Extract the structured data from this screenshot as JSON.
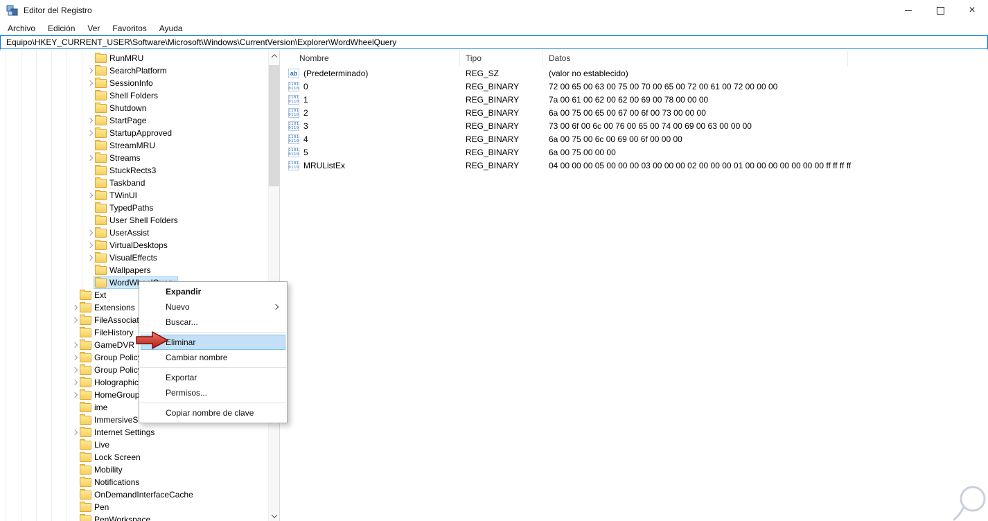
{
  "window": {
    "title": "Editor del Registro"
  },
  "menubar": {
    "items": [
      "Archivo",
      "Edición",
      "Ver",
      "Favoritos",
      "Ayuda"
    ]
  },
  "address_bar": {
    "value": "Equipo\\HKEY_CURRENT_USER\\Software\\Microsoft\\Windows\\CurrentVersion\\Explorer\\WordWheelQuery"
  },
  "icons": {
    "string_glyph": "ab",
    "binary_glyph": "1101\n0110"
  },
  "tree": {
    "items": [
      {
        "label": "RunMRU",
        "level": 2,
        "expandable": false
      },
      {
        "label": "SearchPlatform",
        "level": 2,
        "expandable": true
      },
      {
        "label": "SessionInfo",
        "level": 2,
        "expandable": true
      },
      {
        "label": "Shell Folders",
        "level": 2,
        "expandable": false
      },
      {
        "label": "Shutdown",
        "level": 2,
        "expandable": false
      },
      {
        "label": "StartPage",
        "level": 2,
        "expandable": true
      },
      {
        "label": "StartupApproved",
        "level": 2,
        "expandable": true
      },
      {
        "label": "StreamMRU",
        "level": 2,
        "expandable": false
      },
      {
        "label": "Streams",
        "level": 2,
        "expandable": true
      },
      {
        "label": "StuckRects3",
        "level": 2,
        "expandable": false
      },
      {
        "label": "Taskband",
        "level": 2,
        "expandable": false
      },
      {
        "label": "TWinUI",
        "level": 2,
        "expandable": true
      },
      {
        "label": "TypedPaths",
        "level": 2,
        "expandable": false
      },
      {
        "label": "User Shell Folders",
        "level": 2,
        "expandable": false
      },
      {
        "label": "UserAssist",
        "level": 2,
        "expandable": true
      },
      {
        "label": "VirtualDesktops",
        "level": 2,
        "expandable": true
      },
      {
        "label": "VisualEffects",
        "level": 2,
        "expandable": true
      },
      {
        "label": "Wallpapers",
        "level": 2,
        "expandable": false
      },
      {
        "label": "WordWheelQuery",
        "level": 2,
        "expandable": false,
        "selected": true
      },
      {
        "label": "Ext",
        "level": 1,
        "expandable": false
      },
      {
        "label": "Extensions",
        "level": 1,
        "expandable": true
      },
      {
        "label": "FileAssociation",
        "level": 1,
        "expandable": true
      },
      {
        "label": "FileHistory",
        "level": 1,
        "expandable": false
      },
      {
        "label": "GameDVR",
        "level": 1,
        "expandable": true
      },
      {
        "label": "Group Policy",
        "level": 1,
        "expandable": true
      },
      {
        "label": "Group Policy Objects",
        "level": 1,
        "expandable": true
      },
      {
        "label": "Holographic",
        "level": 1,
        "expandable": true
      },
      {
        "label": "HomeGroup",
        "level": 1,
        "expandable": true
      },
      {
        "label": "ime",
        "level": 1,
        "expandable": false
      },
      {
        "label": "ImmersiveShell",
        "level": 1,
        "expandable": false
      },
      {
        "label": "Internet Settings",
        "level": 1,
        "expandable": true
      },
      {
        "label": "Live",
        "level": 1,
        "expandable": false
      },
      {
        "label": "Lock Screen",
        "level": 1,
        "expandable": false
      },
      {
        "label": "Mobility",
        "level": 1,
        "expandable": false
      },
      {
        "label": "Notifications",
        "level": 1,
        "expandable": false
      },
      {
        "label": "OnDemandInterfaceCache",
        "level": 1,
        "expandable": false
      },
      {
        "label": "Pen",
        "level": 1,
        "expandable": false
      },
      {
        "label": "PenWorkspace",
        "level": 1,
        "expandable": false
      }
    ]
  },
  "list": {
    "columns": [
      {
        "label": "Nombre"
      },
      {
        "label": "Tipo"
      },
      {
        "label": "Datos"
      }
    ],
    "rows": [
      {
        "icon": "string",
        "name": "(Predeterminado)",
        "type": "REG_SZ",
        "data": "(valor no establecido)"
      },
      {
        "icon": "binary",
        "name": "0",
        "type": "REG_BINARY",
        "data": "72 00 65 00 63 00 75 00 70 00 65 00 72 00 61 00 72 00 00 00"
      },
      {
        "icon": "binary",
        "name": "1",
        "type": "REG_BINARY",
        "data": "7a 00 61 00 62 00 62 00 69 00 78 00 00 00"
      },
      {
        "icon": "binary",
        "name": "2",
        "type": "REG_BINARY",
        "data": "6a 00 75 00 65 00 67 00 6f 00 73 00 00 00"
      },
      {
        "icon": "binary",
        "name": "3",
        "type": "REG_BINARY",
        "data": "73 00 6f 00 6c 00 76 00 65 00 74 00 69 00 63 00 00 00"
      },
      {
        "icon": "binary",
        "name": "4",
        "type": "REG_BINARY",
        "data": "6a 00 75 00 6c 00 69 00 6f 00 00 00"
      },
      {
        "icon": "binary",
        "name": "5",
        "type": "REG_BINARY",
        "data": "6a 00 75 00 00 00"
      },
      {
        "icon": "binary",
        "name": "MRUListEx",
        "type": "REG_BINARY",
        "data": "04 00 00 00 05 00 00 00 03 00 00 00 02 00 00 00 01 00 00 00 00 00 00 00 ff ff ff ff"
      }
    ]
  },
  "context_menu": {
    "items": [
      {
        "label": "Expandir",
        "bold": true
      },
      {
        "label": "Nuevo",
        "submenu": true
      },
      {
        "label": "Buscar..."
      },
      {
        "type": "separator"
      },
      {
        "label": "Eliminar",
        "highlighted": true
      },
      {
        "label": "Cambiar nombre"
      },
      {
        "type": "separator"
      },
      {
        "label": "Exportar"
      },
      {
        "label": "Permisos..."
      },
      {
        "type": "separator"
      },
      {
        "label": "Copiar nombre de clave"
      }
    ]
  },
  "colors": {
    "accent": "#0078d7",
    "selection_bg": "#cce8ff",
    "selection_border": "#99d1ff",
    "menu_highlight_bg": "#c4e0f7",
    "menu_highlight_border": "#7fbde8",
    "arrow_red": "#d93025",
    "folder_yellow": "#f6cf5f"
  }
}
